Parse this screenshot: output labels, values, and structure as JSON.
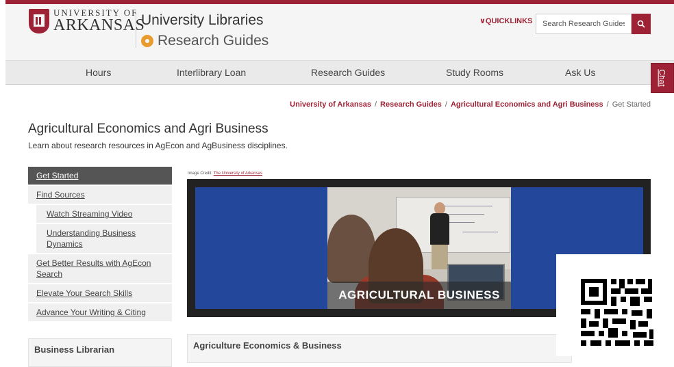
{
  "header": {
    "logo_line1": "UNIVERSITY OF",
    "logo_line2": "ARKANSAS",
    "title": "University Libraries",
    "subtitle": "Research Guides",
    "quicklinks": "∨QUICKLINKS",
    "search_placeholder": "Search Research Guides"
  },
  "nav": {
    "items": [
      {
        "label": "Hours"
      },
      {
        "label": "Interlibrary Loan"
      },
      {
        "label": "Research Guides"
      },
      {
        "label": "Study Rooms"
      },
      {
        "label": "Ask Us"
      }
    ],
    "chat": "Chat"
  },
  "breadcrumb": [
    "University of Arkansas",
    "Research Guides",
    "Agricultural Economics and Agri Business",
    "Get Started"
  ],
  "page": {
    "title": "Agricultural Economics and Agri Business",
    "subtitle": "Learn about research resources in AgEcon and AgBusiness disciplines."
  },
  "sidebar": {
    "items": [
      {
        "label": "Get Started"
      },
      {
        "label": "Find Sources"
      },
      {
        "label": "Watch Streaming Video"
      },
      {
        "label": "Understanding Business Dynamics"
      },
      {
        "label": "Get Better Results with AgEcon Search"
      },
      {
        "label": "Elevate Your Search Skills"
      },
      {
        "label": "Advance Your Writing & Citing"
      }
    ]
  },
  "content": {
    "image_credit_prefix": "Image Credit: ",
    "image_credit_link": "The University of Arkansas",
    "banner_label": "AGRICULTURAL BUSINESS",
    "section_title": "Agriculture Economics & Business",
    "librarian_box_title": "Business Librarian"
  },
  "colors": {
    "brand": "#9d2235",
    "banner_blue": "#23479a",
    "gear": "#e89b2f"
  }
}
